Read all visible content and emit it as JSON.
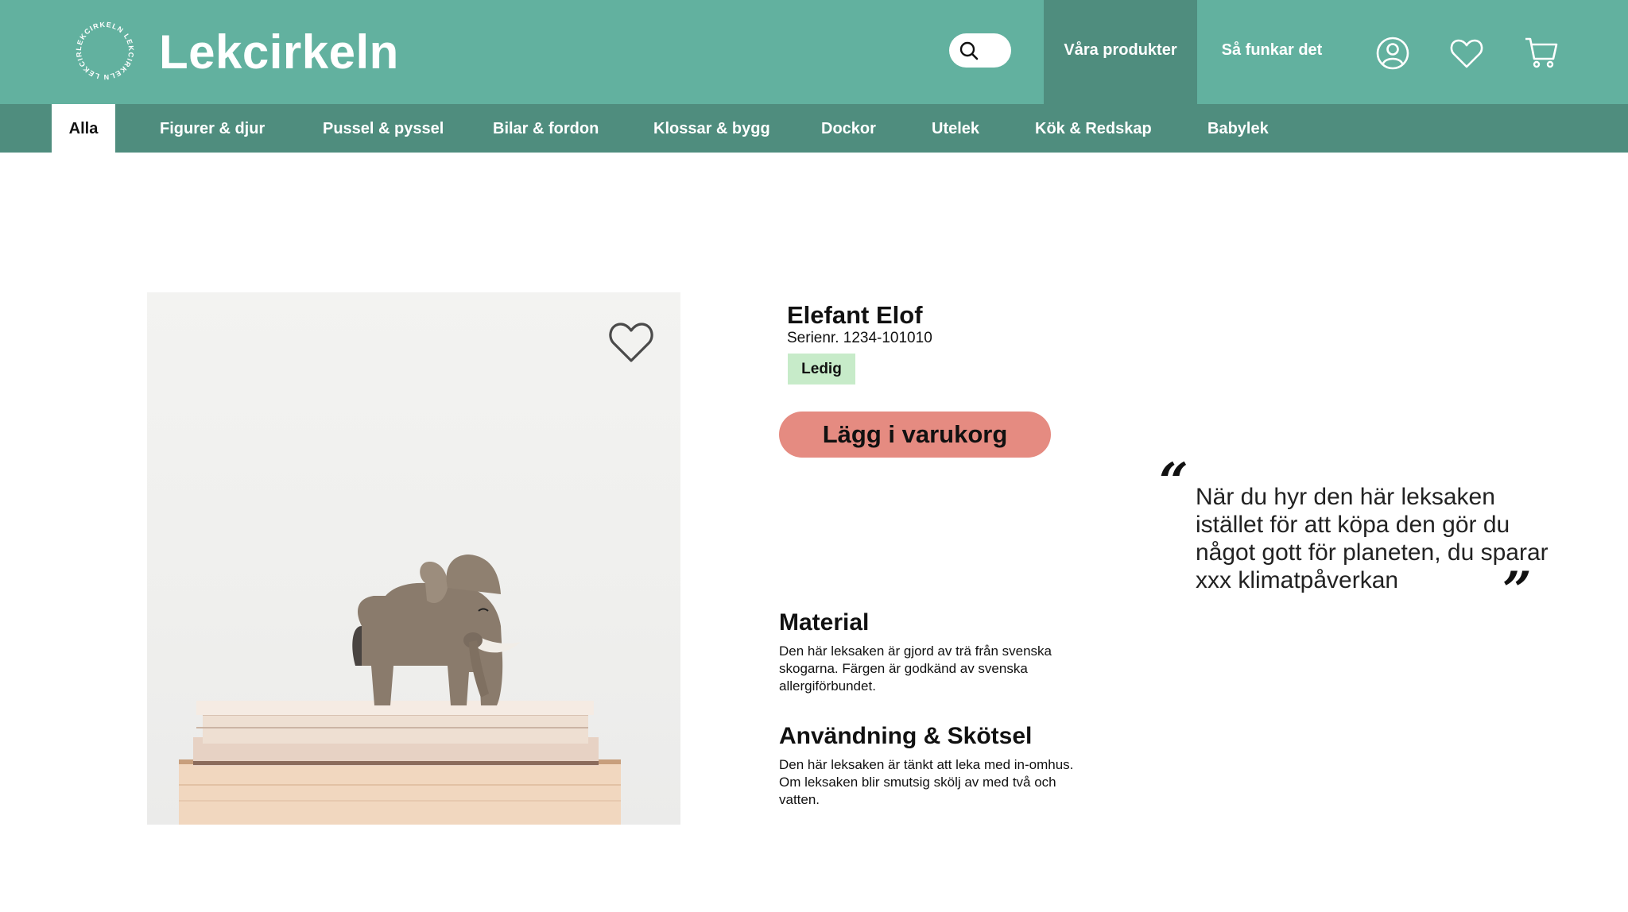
{
  "header": {
    "logo_text": "LEKCIRKELN",
    "brand": "Lekcirkeln",
    "nav_products": "Våra produkter",
    "nav_how": "Så funkar det",
    "icons": [
      "search-icon",
      "user-icon",
      "heart-icon",
      "cart-icon"
    ]
  },
  "categories": {
    "items": [
      {
        "label": "Alla",
        "active": true
      },
      {
        "label": "Figurer & djur"
      },
      {
        "label": "Pussel & pyssel"
      },
      {
        "label": "Bilar & fordon"
      },
      {
        "label": "Klossar & bygg"
      },
      {
        "label": "Dockor"
      },
      {
        "label": "Utelek"
      },
      {
        "label": "Kök & Redskap"
      },
      {
        "label": "Babylek"
      }
    ]
  },
  "product": {
    "name": "Elefant Elof",
    "serial": "Serienr. 1234-101010",
    "status": "Ledig",
    "cart_button": "Lägg i varukorg"
  },
  "sections": {
    "material": {
      "heading": "Material",
      "text": "Den här leksaken är gjord av trä från svenska skogarna. Färgen är godkänd av svenska allergiförbundet."
    },
    "care": {
      "heading": "Användning & Skötsel",
      "text": "Den här leksaken är tänkt att leka med in-omhus. Om leksaken blir smutsig skölj av med två och vatten."
    }
  },
  "quote": {
    "open": "“",
    "close": "”",
    "text": "När du hyr den här leksaken istället för att köpa den gör du något gott för planeten, du sparar xxx klimatpåverkan"
  },
  "colors": {
    "header": "#62b19f",
    "category_bar": "#4f8d7e",
    "cart_button": "#e58b81",
    "status_badge": "#c7ebc9"
  }
}
